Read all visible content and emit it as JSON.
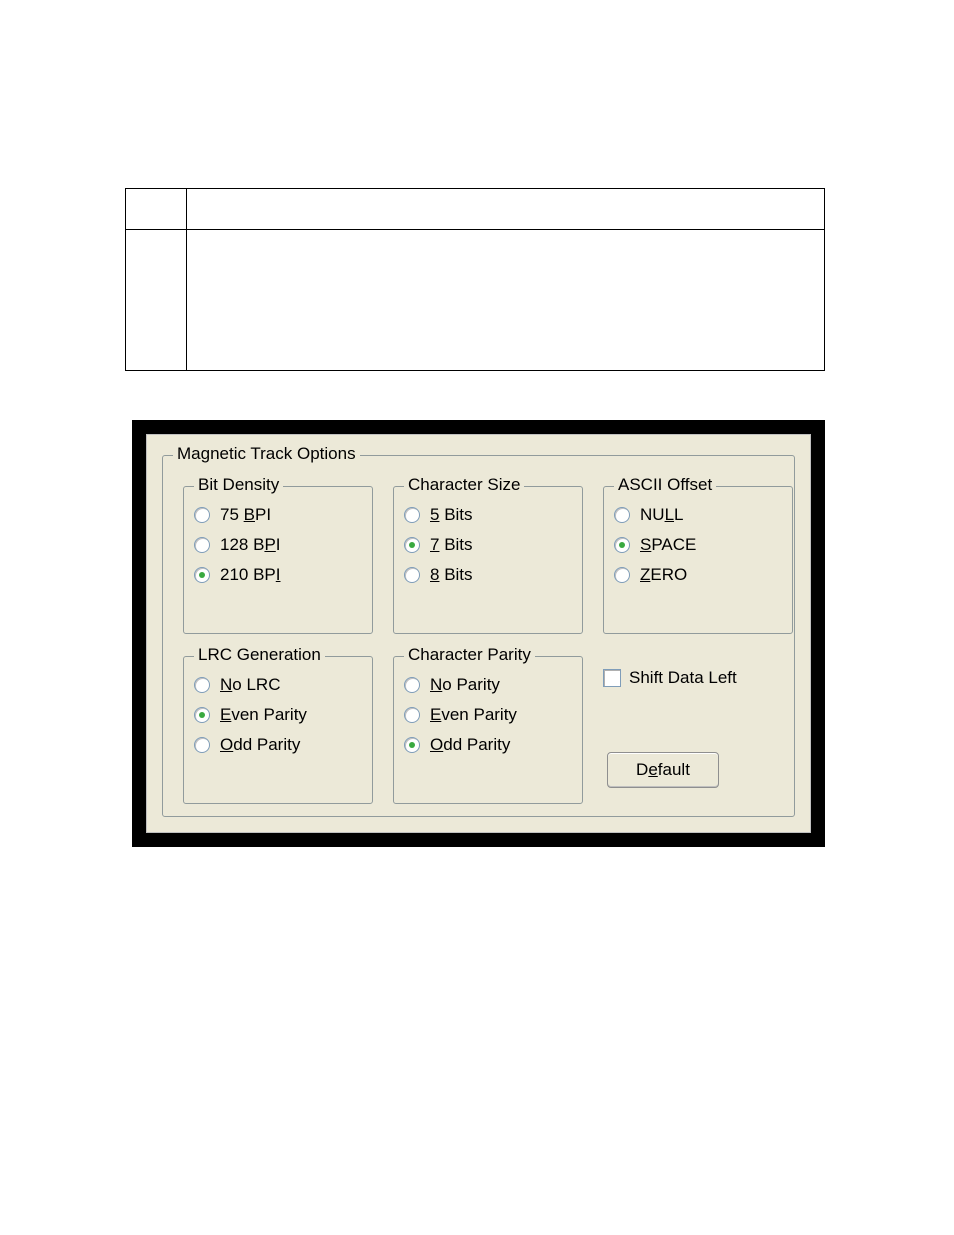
{
  "groups": {
    "main": {
      "legend": "Magnetic Track Options"
    },
    "bitDensity": {
      "legend": "Bit Density",
      "options": [
        {
          "label_pre": " 75 ",
          "ul": "B",
          "label_post": "PI",
          "selected": false
        },
        {
          "label_pre": "128 B",
          "ul": "P",
          "label_post": "I",
          "selected": false
        },
        {
          "label_pre": "210 BP",
          "ul": "I",
          "label_post": "",
          "selected": true
        }
      ]
    },
    "charSize": {
      "legend": "Character Size",
      "options": [
        {
          "label_pre": "",
          "ul": "5",
          "label_post": " Bits",
          "selected": false
        },
        {
          "label_pre": "",
          "ul": "7",
          "label_post": " Bits",
          "selected": true
        },
        {
          "label_pre": "",
          "ul": "8",
          "label_post": " Bits",
          "selected": false
        }
      ]
    },
    "asciiOffset": {
      "legend": "ASCII Offset",
      "options": [
        {
          "label_pre": "NU",
          "ul": "L",
          "label_post": "L",
          "selected": false
        },
        {
          "label_pre": "",
          "ul": "S",
          "label_post": "PACE",
          "selected": true
        },
        {
          "label_pre": "",
          "ul": "Z",
          "label_post": "ERO",
          "selected": false
        }
      ]
    },
    "lrc": {
      "legend": "LRC Generation",
      "options": [
        {
          "label_pre": "",
          "ul": "N",
          "label_post": "o LRC",
          "selected": false
        },
        {
          "label_pre": "",
          "ul": "E",
          "label_post": "ven Parity",
          "selected": true
        },
        {
          "label_pre": "",
          "ul": "O",
          "label_post": "dd Parity",
          "selected": false
        }
      ]
    },
    "charParity": {
      "legend": "Character Parity",
      "options": [
        {
          "label_pre": "",
          "ul": "N",
          "label_post": "o Parity",
          "selected": false
        },
        {
          "label_pre": "",
          "ul": "E",
          "label_post": "ven Parity",
          "selected": false
        },
        {
          "label_pre": "",
          "ul": "O",
          "label_post": "dd Parity",
          "selected": true
        }
      ]
    }
  },
  "shiftLeft": {
    "label": "Shift Data Left",
    "checked": false
  },
  "defaultBtn": {
    "pre": "D",
    "ul": "e",
    "post": "fault"
  }
}
